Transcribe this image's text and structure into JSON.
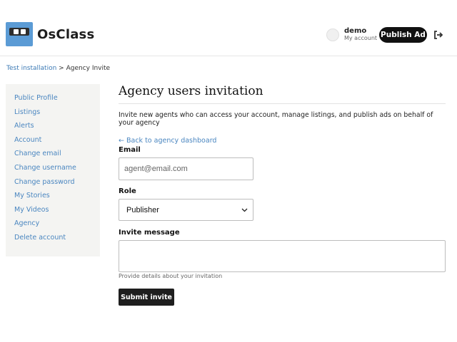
{
  "header": {
    "logo_text": "OsClass",
    "user_name": "demo",
    "user_sub": "My account",
    "publish_label": "Publish Ad"
  },
  "breadcrumb": {
    "home": "Test installation",
    "separator": ">",
    "current": "Agency Invite"
  },
  "sidebar": {
    "items": [
      {
        "label": "Public Profile"
      },
      {
        "label": "Listings"
      },
      {
        "label": "Alerts"
      },
      {
        "label": "Account"
      },
      {
        "label": "Change email"
      },
      {
        "label": "Change username"
      },
      {
        "label": "Change password"
      },
      {
        "label": "My Stories"
      },
      {
        "label": "My Videos"
      },
      {
        "label": "Agency"
      },
      {
        "label": "Delete account"
      }
    ]
  },
  "main": {
    "title": "Agency users invitation",
    "intro": "Invite new agents who can access your account, manage listings, and publish ads on behalf of your agency",
    "back_link": "← Back to agency dashboard",
    "email_label": "Email",
    "email_placeholder": "agent@email.com",
    "role_label": "Role",
    "role_value": "Publisher",
    "message_label": "Invite message",
    "message_help": "Provide details about your invitation",
    "submit_label": "Submit invite"
  },
  "colors": {
    "accent": "#4a86c0",
    "logo_blue": "#5b9bd5",
    "button_dark": "#111111"
  }
}
